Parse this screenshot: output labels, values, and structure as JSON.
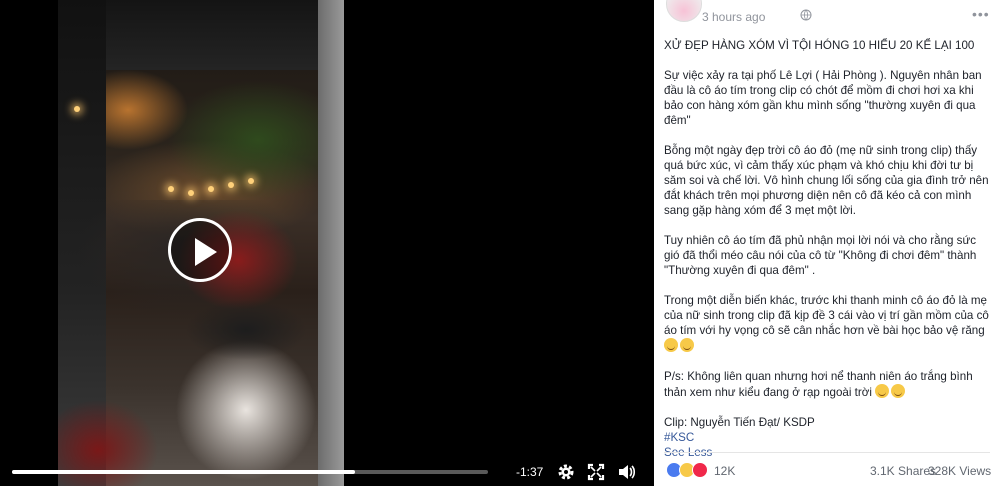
{
  "video": {
    "time_remaining": "-1:37",
    "progress_fraction": 0.72,
    "icons": [
      "play-icon",
      "settings-gear-icon",
      "fullscreen-icon",
      "volume-icon"
    ]
  },
  "post": {
    "timestamp": "3 hours ago",
    "paragraphs": [
      "XỬ ĐẸP HÀNG XÓM VÌ TỘI HÓNG 10 HIỂU 20 KỂ LẠI 100",
      "Sự việc xảy ra tại phố Lê Lợi ( Hải Phòng ). Nguyên nhân ban đầu là cô áo tím trong clip có chót để mồm đi chơi hơi xa khi bảo con hàng xóm gần khu mình sống \"thường xuyên đi qua đêm\"",
      "Bỗng một ngày đẹp trời cô áo đỏ (mẹ nữ sinh trong clip) thấy quá bức xúc, vì cảm thấy xúc phạm và khó chịu khi đời tư bị săm soi và chế lời. Vô hình chung lối sống của gia đình trở nên đắt khách trên mọi phương diện nên cô đã kéo cả con mình sang gặp hàng xóm để 3 mẹt một lời.",
      "Tuy nhiên cô áo tím đã phủ nhận mọi lời nói và cho rằng sức gió đã thổi méo câu nói của cô từ \"Không đi chơi đêm\" thành \"Thường xuyên đi qua đêm\" .",
      "Trong một diễn biến khác, trước khi thanh minh cô áo đỏ là mẹ của nữ sinh trong clip đã kịp đề 3 cái vào vị trí gần mồm của cô áo tím với hy vọng cô sẽ cân nhắc hơn về bài học bảo vệ răng",
      "P/s: Không liên quan nhưng hơi nể thanh niên áo trắng bình thản xem như kiểu đang ở rạp ngoài trời"
    ],
    "credit": "Clip: Nguyễn Tiến Đạt/ KSDP",
    "hashtag": "#KSC",
    "see_less": "See Less"
  },
  "footer": {
    "reaction_count": "12K",
    "shares": "3.1K Shares",
    "views": "328K Views"
  },
  "colors": {
    "link": "#365899",
    "meta": "#90949c",
    "text": "#1d2129"
  }
}
